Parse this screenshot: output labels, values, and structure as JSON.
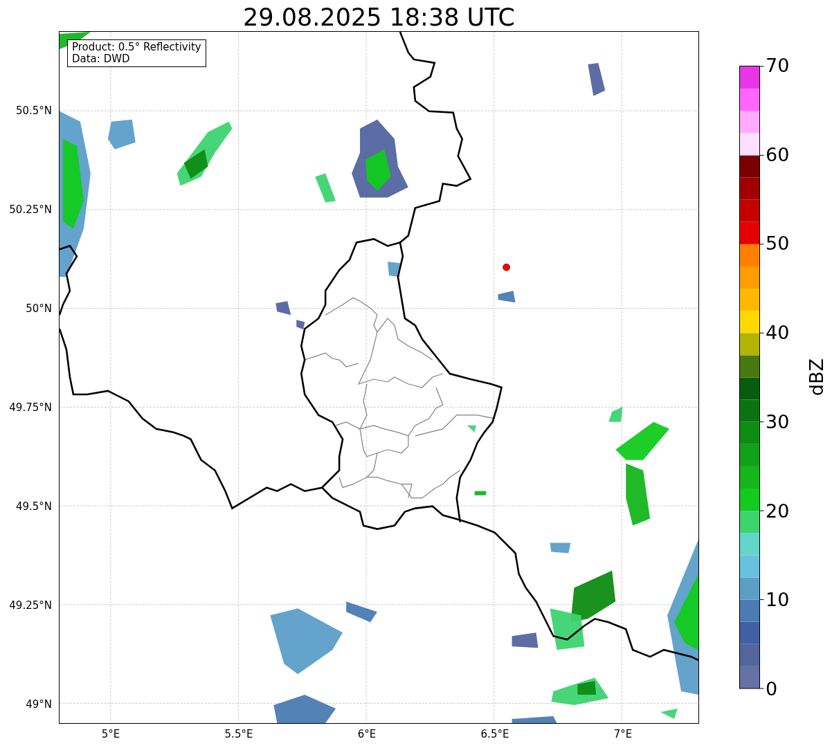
{
  "title": "29.08.2025 18:38 UTC",
  "info_box": [
    "Product: 0.5° Reflectivity",
    "Data: DWD"
  ],
  "map": {
    "x_ticks": [
      "5°E",
      "5.5°E",
      "6°E",
      "6.5°E",
      "7°E"
    ],
    "y_ticks": [
      "50.5°N",
      "50.25°N",
      "50°N",
      "49.75°N",
      "49.5°N",
      "49.25°N",
      "49°N"
    ]
  },
  "colorbar": {
    "label": "dBZ",
    "ticks": [
      "70",
      "60",
      "50",
      "40",
      "30",
      "20",
      "10",
      "0"
    ]
  }
}
